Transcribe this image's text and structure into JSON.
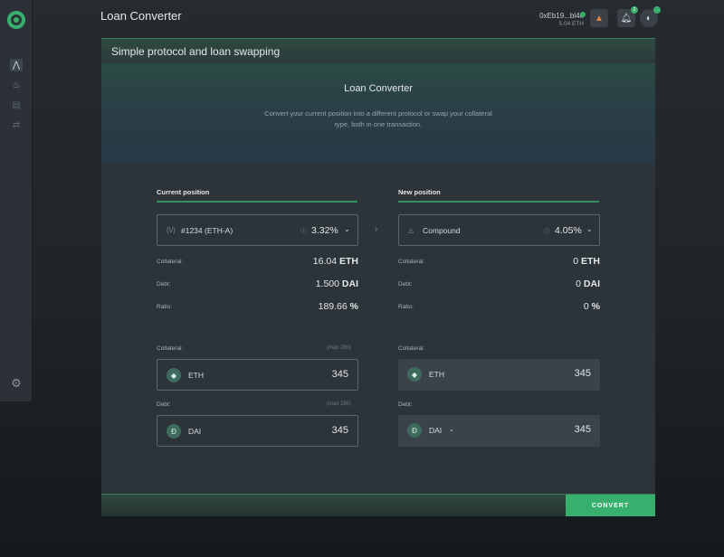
{
  "app": {
    "page_title": "Loan Converter",
    "account_address": "0xEb19...bl4e",
    "account_balance": "5.04 ETH",
    "notification_count": "2"
  },
  "panel": {
    "header": "Simple protocol and loan swapping",
    "hero_title": "Loan Converter",
    "hero_description": "Convert your current position into a different protocol or swap your collateral type, both in one transaction.",
    "convert_label": "CONVERT"
  },
  "current": {
    "title": "Current position",
    "select_icon": "(\\/)",
    "select_label": "#1234 (ETH-A)",
    "info_icon": "ⓘ",
    "ratio": "3.32%",
    "stats": {
      "collateral_label": "Collateral:",
      "collateral_num": "16.04",
      "collateral_unit": "ETH",
      "debt_label": "Debt:",
      "debt_num": "1.500",
      "debt_unit": "DAI",
      "ratio_label": "Ratio:",
      "ratio_num": "189.66",
      "ratio_unit": "%"
    },
    "collateral_field": {
      "label": "Collateral:",
      "max": "(max 280)",
      "coin": "ETH",
      "value": "345"
    },
    "debt_field": {
      "label": "Debt:",
      "max": "(max 280)",
      "coin": "DAI",
      "value": "345"
    }
  },
  "new": {
    "title": "New position",
    "select_label": "Compound",
    "info_icon": "ⓘ",
    "ratio": "4.05%",
    "stats": {
      "collateral_label": "Collateral:",
      "collateral_num": "0",
      "collateral_unit": "ETH",
      "debt_label": "Debt:",
      "debt_num": "0",
      "debt_unit": "DAI",
      "ratio_label": "Ratio:",
      "ratio_num": "0",
      "ratio_unit": "%"
    },
    "collateral_field": {
      "label": "Collateral:",
      "coin": "ETH",
      "value": "345"
    },
    "debt_field": {
      "label": "Debt:",
      "coin": "DAI",
      "value": "345"
    }
  },
  "colors": {
    "accent": "#37b06e",
    "background": "#1f2428",
    "panel": "#2c3339"
  }
}
